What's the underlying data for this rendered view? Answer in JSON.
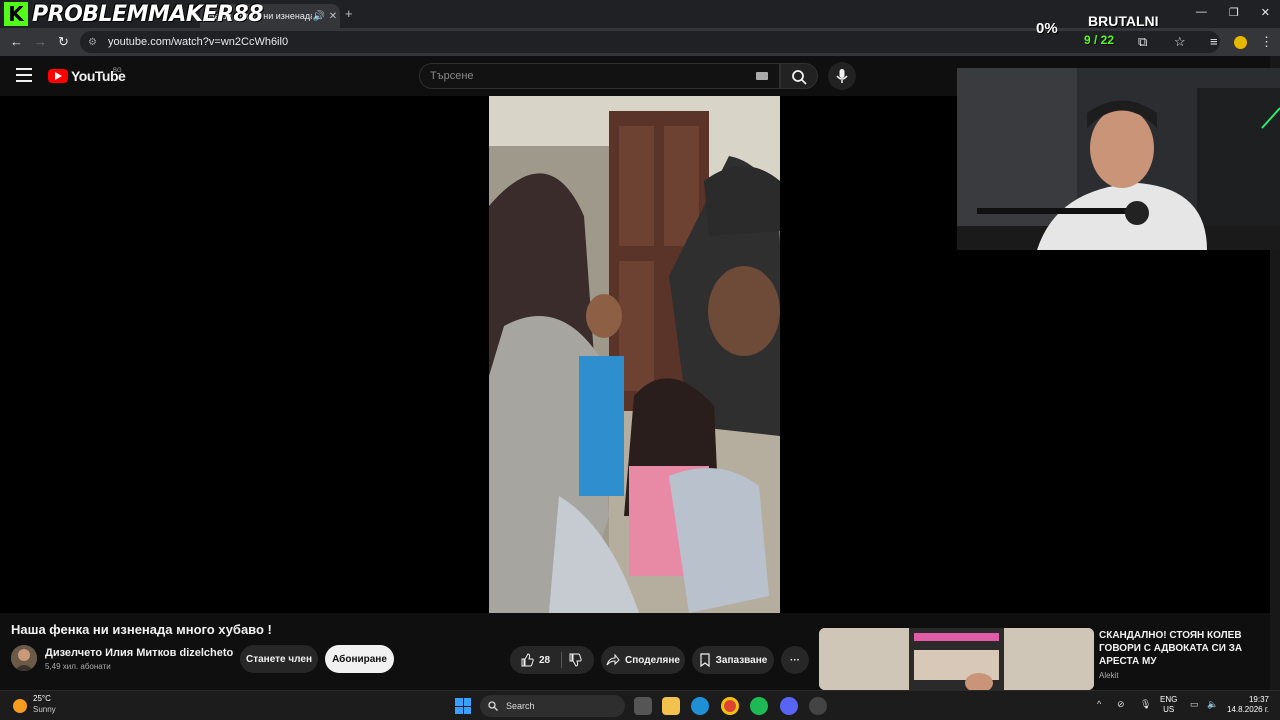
{
  "browser": {
    "tab_title": "Наша фенка ни изненада",
    "url": "youtube.com/watch?v=wn2CcWh6il0"
  },
  "overlay": {
    "streamer_logo": "PROBLEMMAKER88",
    "percent": "0%",
    "name": "BRUTALNI",
    "count": "9 / 22",
    "accent_color": "#53fc18"
  },
  "youtube": {
    "logo_text": "YouTube",
    "country_code": "BG",
    "search": {
      "placeholder": "Търсене"
    },
    "video": {
      "title": "Наша фенка ни изненада много хубаво !",
      "channel_name": "Дизелчето Илия Митков dizelcheto",
      "subscribers": "5,49 хил. абонати",
      "join_label": "Станете член",
      "subscribe_label": "Абониране",
      "likes": "28",
      "share_label": "Споделяне",
      "save_label": "Запазване",
      "more_label": "···"
    },
    "recommendation": {
      "title": "СКАНДАЛНО! СТОЯН КОЛЕВ ГОВОРИ С АДВОКАТА СИ ЗА АРЕСТА МУ",
      "channel": "Alekit"
    }
  },
  "taskbar": {
    "temperature": "25°C",
    "weather": "Sunny",
    "search_label": "Search",
    "lang_line1": "ENG",
    "lang_line2": "US",
    "time": "19:37",
    "date": "14.8.2026 г."
  }
}
